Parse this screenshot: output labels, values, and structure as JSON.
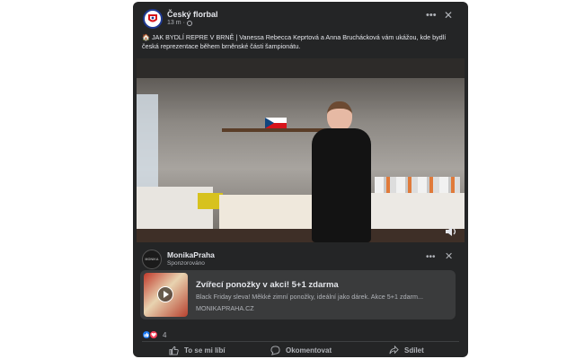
{
  "post": {
    "page_name": "Český florbal",
    "time": "13 m",
    "separator": "·",
    "text": "🏠 JAK BYDLÍ REPRE V BRNĚ | Vanessa Rebecca Keprtová a Anna Bruchácková vám ukážou, kde bydlí česká reprezentace během brněnské části šampionátu."
  },
  "ad": {
    "advertiser": "MonikaPraha",
    "sponsored_label": "Sponzorováno",
    "logo_text": "MONIKA",
    "title": "Zvířecí ponožky v akci! 5+1 zdarma",
    "description": "Black Friday sleva! Měkké zimní ponožky, ideální jako dárek. Akce 5+1 zdarm...",
    "url": "MONIKAPRAHA.CZ"
  },
  "reactions": {
    "count": "4"
  },
  "actions": {
    "like": "To se mi líbí",
    "comment": "Okomentovat",
    "share": "Sdílet"
  },
  "icons": {
    "more": "more-icon",
    "close": "close-icon",
    "sound": "sound-icon",
    "play": "play-icon"
  },
  "colors": {
    "card_bg": "#242526",
    "ad_box_bg": "#3a3b3c",
    "like_blue": "#1877f2",
    "love_red": "#f33e58",
    "text_primary": "#e4e6eb",
    "text_secondary": "#b0b3b8"
  }
}
